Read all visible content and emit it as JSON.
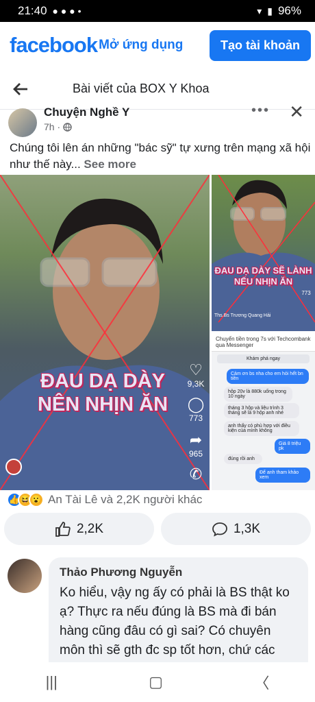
{
  "status": {
    "time": "21:40",
    "battery": "96%"
  },
  "header": {
    "logo": "facebook",
    "open_app": "Mở ứng dụng",
    "create_account": "Tạo tài khoản"
  },
  "nav": {
    "title": "Bài viết của BOX Y Khoa"
  },
  "post": {
    "author": "Chuyện Nghề Y",
    "time": "7h ·",
    "text": "Chúng tôi lên án những \"bác sỹ\" tự xưng trên mạng xã hội như thế này...",
    "see_more": "See more",
    "main_caption_line1": "ĐAU DẠ DÀY",
    "main_caption_line2": "NÊN NHỊN ĂN",
    "main_likes": "9,3K",
    "main_comments": "773",
    "main_shares": "965",
    "side_caption_line1": "ĐAU DẠ DÀY SẼ LÀNH",
    "side_caption_line2": "NẾU NHỊN ĂN",
    "side_count1": "773",
    "side_channel": "Ths.Bs Trương Quang Hải",
    "chat_title": "Chuyển tiền trong 7s với Techcombank qua Messenger",
    "chat_button": "Khám phá ngay",
    "chat_messages": [
      {
        "dir": "out",
        "text": "Cảm ơn bs nha cho em hỏi hết bn tiền"
      },
      {
        "dir": "in",
        "text": "hộp 20v là 880k uống trong 10 ngày"
      },
      {
        "dir": "in",
        "text": "tháng 3 hộp và liệu trình 3 tháng sẽ là 9 hộp anh nhé"
      },
      {
        "dir": "in",
        "text": "anh thấy có phù hợp với điều kiện của mình không"
      },
      {
        "dir": "out",
        "text": "Giá 8 triệu pk"
      },
      {
        "dir": "in",
        "text": "đúng rồi anh"
      },
      {
        "dir": "out",
        "text": "Để anh tham khảo xem"
      }
    ]
  },
  "reactions": {
    "text": "An Tài Lê và 2,2K người khác"
  },
  "actions": {
    "likes": "2,2K",
    "comments": "1,3K"
  },
  "comment": {
    "name": "Thảo Phương Nguyễn",
    "text": "Ko hiểu, vậy ng ấy có phải là BS thật ko ạ? Thực ra nếu đúng là BS mà đi bán hàng cũng đâu có gì sai? Có chuyên môn thì sẽ gth đc sp tốt hơn, chứ các bác đi mua TPCN ở mấy"
  }
}
